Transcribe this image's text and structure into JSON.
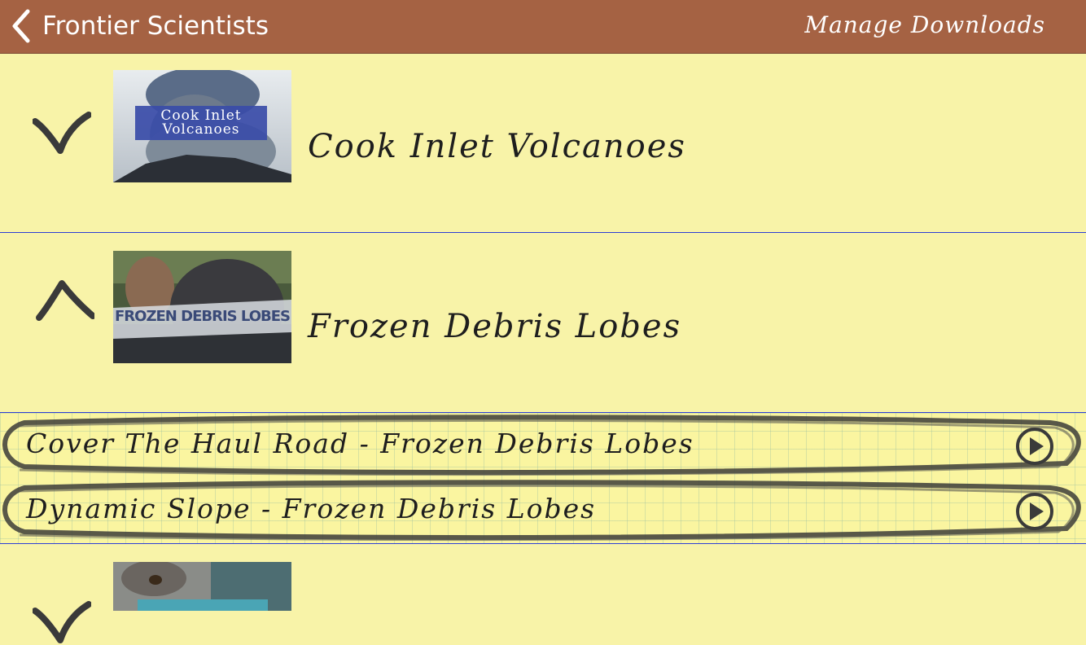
{
  "navbar": {
    "back_label": "Frontier Scientists",
    "action_label": "Manage Downloads",
    "background": "#a56243"
  },
  "items": [
    {
      "title": "Cook Inlet Volcanoes",
      "thumb_text": "Cook Inlet Volcanoes",
      "status_icon": "check-icon"
    },
    {
      "title": "Frozen Debris Lobes",
      "thumb_text": "FROZEN DEBRIS LOBES",
      "status_icon": "chevron-up-icon",
      "expanded": true
    },
    {
      "title": "",
      "status_icon": "check-icon"
    }
  ],
  "subitems": [
    {
      "label": "Cover The Haul Road - Frozen Debris Lobes",
      "icon": "play-icon"
    },
    {
      "label": "Dynamic Slope - Frozen Debris Lobes",
      "icon": "play-icon"
    }
  ],
  "colors": {
    "background": "#f8f3a8",
    "separator": "#2d3ed6",
    "ink": "#1e1e1e"
  }
}
